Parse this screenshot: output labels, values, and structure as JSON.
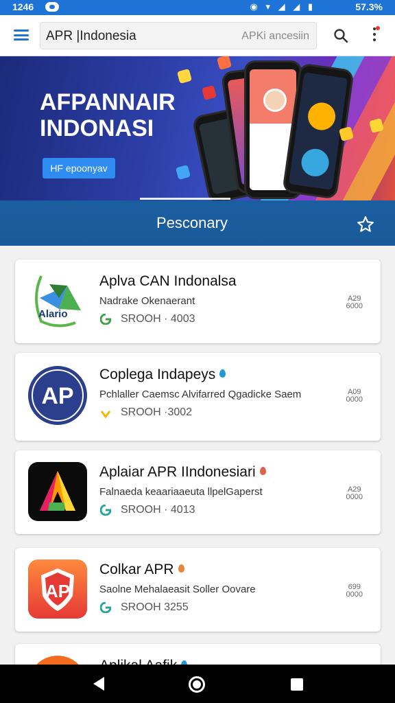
{
  "status_bar": {
    "time": "1246",
    "battery": "57.3%"
  },
  "app_bar": {
    "search_value": "APR |Indonesia",
    "search_hint": "APKi ancesiin"
  },
  "banner": {
    "title_line1": "AFPANNAIR",
    "title_line2": "INDONASI",
    "button_label": "HF epoonyav"
  },
  "section": {
    "title": "Pesconary"
  },
  "apps": [
    {
      "title": "Aplva CAN Indonalsa",
      "subtitle": "Nadrake Okenaerant",
      "meta": "SROOH · 4003",
      "side_top": "A29",
      "side_bottom": "6000",
      "logo_text": "Alario"
    },
    {
      "title": "Coplega Indapeys",
      "subtitle": "Pchlaller Caemsc Alvifarred Qgadicke Saem",
      "meta": "SROOH ·3002",
      "side_top": "A09",
      "side_bottom": "0000",
      "logo_text": "AP"
    },
    {
      "title": "Aplaiar APR IIndonesiari",
      "subtitle": "Falnaeda keaariaaeuta llpelGaperst",
      "meta": "SROOH · 4013",
      "side_top": "A29",
      "side_bottom": "0000",
      "logo_text": ""
    },
    {
      "title": "Colkar APR",
      "subtitle": "Saolne Mehalaeasit Soller Oovare",
      "meta": "SROOH 3255",
      "side_top": "699",
      "side_bottom": "0000",
      "logo_text": "AP"
    },
    {
      "title": "Aplikal Aafik",
      "subtitle": "",
      "meta": "",
      "side_top": "",
      "side_bottom": "",
      "logo_text": ""
    }
  ],
  "icons": {
    "menu": "hamburger-menu-icon",
    "search": "search-icon",
    "more": "more-vertical-icon",
    "star": "star-outline-icon",
    "nav_back": "back-triangle-icon",
    "nav_home": "home-circle-icon",
    "nav_recent": "recent-square-icon"
  },
  "colors": {
    "accent": "#1d73d6",
    "section_header": "#1b5ea0",
    "banner_dark": "#1b2a7a"
  }
}
